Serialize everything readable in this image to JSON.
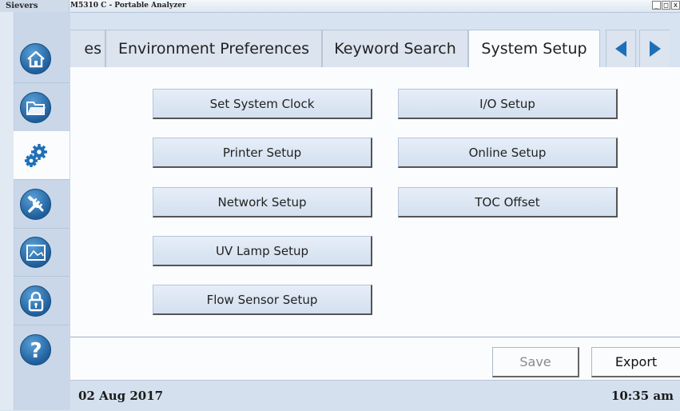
{
  "titlebar": {
    "brand": "Sievers",
    "app_title": "M5310 C - Portable Analyzer",
    "minimize": "_",
    "maximize": "□",
    "close": "x"
  },
  "sidebar": {
    "items": [
      {
        "name": "home",
        "icon": "home-icon"
      },
      {
        "name": "folder",
        "icon": "folder-icon"
      },
      {
        "name": "settings",
        "icon": "gears-icon",
        "active": true
      },
      {
        "name": "tools",
        "icon": "tools-icon"
      },
      {
        "name": "chart",
        "icon": "chart-icon"
      },
      {
        "name": "lock",
        "icon": "lock-icon"
      },
      {
        "name": "help",
        "icon": "help-icon"
      }
    ]
  },
  "tabs": {
    "items": [
      "es",
      "Environment Preferences",
      "Keyword Search",
      "System Setup"
    ],
    "active": "System Setup",
    "prev_icon": "triangle-left-icon",
    "next_icon": "triangle-right-icon"
  },
  "buttons": {
    "set_system_clock": "Set System Clock",
    "printer_setup": "Printer Setup",
    "network_setup": "Network Setup",
    "uv_lamp_setup": "UV Lamp Setup",
    "flow_sensor_setup": "Flow Sensor Setup",
    "io_setup": "I/O Setup",
    "online_setup": "Online Setup",
    "toc_offset": "TOC Offset"
  },
  "actions": {
    "save": "Save",
    "export": "Export"
  },
  "status": {
    "date": "02 Aug 2017",
    "time": "10:35 am"
  },
  "colors": {
    "accent_blue": "#1f6fb7",
    "panel_bg": "#fbfcfe",
    "button_bg": "#dbe6f3"
  }
}
